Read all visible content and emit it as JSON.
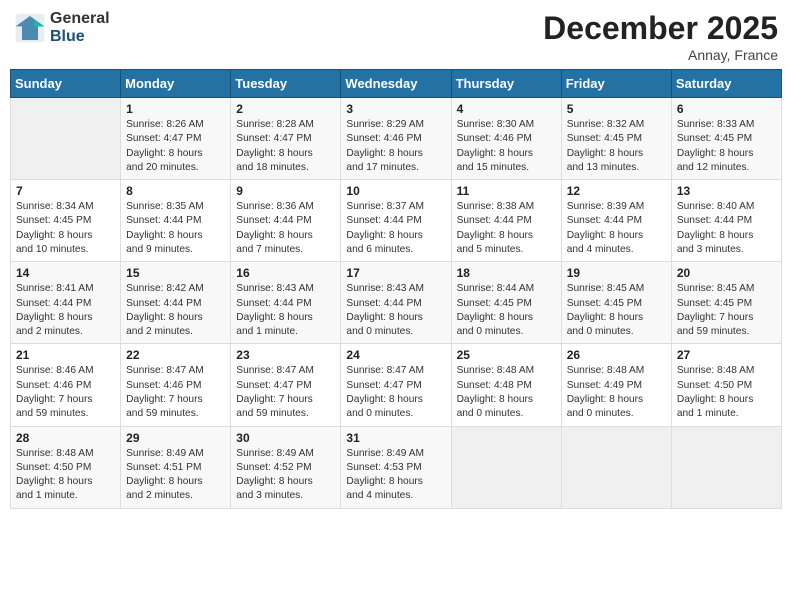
{
  "logo": {
    "general": "General",
    "blue": "Blue"
  },
  "title": "December 2025",
  "location": "Annay, France",
  "headers": [
    "Sunday",
    "Monday",
    "Tuesday",
    "Wednesday",
    "Thursday",
    "Friday",
    "Saturday"
  ],
  "weeks": [
    [
      {
        "day": "",
        "info": ""
      },
      {
        "day": "1",
        "info": "Sunrise: 8:26 AM\nSunset: 4:47 PM\nDaylight: 8 hours\nand 20 minutes."
      },
      {
        "day": "2",
        "info": "Sunrise: 8:28 AM\nSunset: 4:47 PM\nDaylight: 8 hours\nand 18 minutes."
      },
      {
        "day": "3",
        "info": "Sunrise: 8:29 AM\nSunset: 4:46 PM\nDaylight: 8 hours\nand 17 minutes."
      },
      {
        "day": "4",
        "info": "Sunrise: 8:30 AM\nSunset: 4:46 PM\nDaylight: 8 hours\nand 15 minutes."
      },
      {
        "day": "5",
        "info": "Sunrise: 8:32 AM\nSunset: 4:45 PM\nDaylight: 8 hours\nand 13 minutes."
      },
      {
        "day": "6",
        "info": "Sunrise: 8:33 AM\nSunset: 4:45 PM\nDaylight: 8 hours\nand 12 minutes."
      }
    ],
    [
      {
        "day": "7",
        "info": "Sunrise: 8:34 AM\nSunset: 4:45 PM\nDaylight: 8 hours\nand 10 minutes."
      },
      {
        "day": "8",
        "info": "Sunrise: 8:35 AM\nSunset: 4:44 PM\nDaylight: 8 hours\nand 9 minutes."
      },
      {
        "day": "9",
        "info": "Sunrise: 8:36 AM\nSunset: 4:44 PM\nDaylight: 8 hours\nand 7 minutes."
      },
      {
        "day": "10",
        "info": "Sunrise: 8:37 AM\nSunset: 4:44 PM\nDaylight: 8 hours\nand 6 minutes."
      },
      {
        "day": "11",
        "info": "Sunrise: 8:38 AM\nSunset: 4:44 PM\nDaylight: 8 hours\nand 5 minutes."
      },
      {
        "day": "12",
        "info": "Sunrise: 8:39 AM\nSunset: 4:44 PM\nDaylight: 8 hours\nand 4 minutes."
      },
      {
        "day": "13",
        "info": "Sunrise: 8:40 AM\nSunset: 4:44 PM\nDaylight: 8 hours\nand 3 minutes."
      }
    ],
    [
      {
        "day": "14",
        "info": "Sunrise: 8:41 AM\nSunset: 4:44 PM\nDaylight: 8 hours\nand 2 minutes."
      },
      {
        "day": "15",
        "info": "Sunrise: 8:42 AM\nSunset: 4:44 PM\nDaylight: 8 hours\nand 2 minutes."
      },
      {
        "day": "16",
        "info": "Sunrise: 8:43 AM\nSunset: 4:44 PM\nDaylight: 8 hours\nand 1 minute."
      },
      {
        "day": "17",
        "info": "Sunrise: 8:43 AM\nSunset: 4:44 PM\nDaylight: 8 hours\nand 0 minutes."
      },
      {
        "day": "18",
        "info": "Sunrise: 8:44 AM\nSunset: 4:45 PM\nDaylight: 8 hours\nand 0 minutes."
      },
      {
        "day": "19",
        "info": "Sunrise: 8:45 AM\nSunset: 4:45 PM\nDaylight: 8 hours\nand 0 minutes."
      },
      {
        "day": "20",
        "info": "Sunrise: 8:45 AM\nSunset: 4:45 PM\nDaylight: 7 hours\nand 59 minutes."
      }
    ],
    [
      {
        "day": "21",
        "info": "Sunrise: 8:46 AM\nSunset: 4:46 PM\nDaylight: 7 hours\nand 59 minutes."
      },
      {
        "day": "22",
        "info": "Sunrise: 8:47 AM\nSunset: 4:46 PM\nDaylight: 7 hours\nand 59 minutes."
      },
      {
        "day": "23",
        "info": "Sunrise: 8:47 AM\nSunset: 4:47 PM\nDaylight: 7 hours\nand 59 minutes."
      },
      {
        "day": "24",
        "info": "Sunrise: 8:47 AM\nSunset: 4:47 PM\nDaylight: 8 hours\nand 0 minutes."
      },
      {
        "day": "25",
        "info": "Sunrise: 8:48 AM\nSunset: 4:48 PM\nDaylight: 8 hours\nand 0 minutes."
      },
      {
        "day": "26",
        "info": "Sunrise: 8:48 AM\nSunset: 4:49 PM\nDaylight: 8 hours\nand 0 minutes."
      },
      {
        "day": "27",
        "info": "Sunrise: 8:48 AM\nSunset: 4:50 PM\nDaylight: 8 hours\nand 1 minute."
      }
    ],
    [
      {
        "day": "28",
        "info": "Sunrise: 8:48 AM\nSunset: 4:50 PM\nDaylight: 8 hours\nand 1 minute."
      },
      {
        "day": "29",
        "info": "Sunrise: 8:49 AM\nSunset: 4:51 PM\nDaylight: 8 hours\nand 2 minutes."
      },
      {
        "day": "30",
        "info": "Sunrise: 8:49 AM\nSunset: 4:52 PM\nDaylight: 8 hours\nand 3 minutes."
      },
      {
        "day": "31",
        "info": "Sunrise: 8:49 AM\nSunset: 4:53 PM\nDaylight: 8 hours\nand 4 minutes."
      },
      {
        "day": "",
        "info": ""
      },
      {
        "day": "",
        "info": ""
      },
      {
        "day": "",
        "info": ""
      }
    ]
  ]
}
